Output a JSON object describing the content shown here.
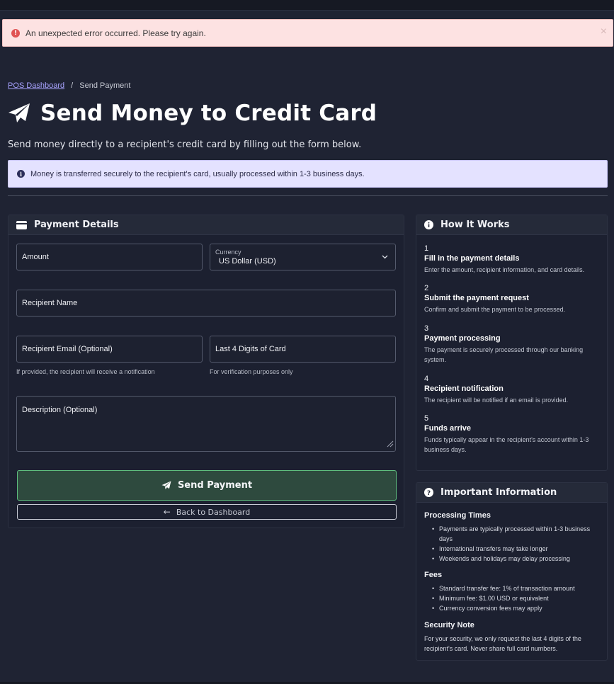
{
  "alert": {
    "message": "An unexpected error occurred. Please try again.",
    "close": "×"
  },
  "breadcrumb": {
    "home": "POS Dashboard",
    "separator": "/",
    "current": "Send Payment"
  },
  "page": {
    "title": "Send Money to Credit Card",
    "subtitle": "Send money directly to a recipient's credit card by filling out the form below.",
    "info": "Money is transferred securely to the recipient's card, usually processed within 1-3 business days."
  },
  "form": {
    "header": "Payment Details",
    "amount_label": "Amount",
    "currency_label": "Currency",
    "currency_value": "US Dollar (USD)",
    "recipient_name_label": "Recipient Name",
    "recipient_email_label": "Recipient Email (Optional)",
    "recipient_email_help": "If provided, the recipient will receive a notification",
    "last4_label": "Last 4 Digits of Card",
    "last4_help": "For verification purposes only",
    "description_label": "Description (Optional)",
    "send_label": "Send Payment",
    "back_label": "Back to Dashboard"
  },
  "how_it_works": {
    "header": "How It Works",
    "steps": [
      {
        "num": "1",
        "title": "Fill in the payment details",
        "desc": "Enter the amount, recipient information, and card details."
      },
      {
        "num": "2",
        "title": "Submit the payment request",
        "desc": "Confirm and submit the payment to be processed."
      },
      {
        "num": "3",
        "title": "Payment processing",
        "desc": "The payment is securely processed through our banking system."
      },
      {
        "num": "4",
        "title": "Recipient notification",
        "desc": "The recipient will be notified if an email is provided."
      },
      {
        "num": "5",
        "title": "Funds arrive",
        "desc": "Funds typically appear in the recipient's account within 1-3 business days."
      }
    ]
  },
  "important": {
    "header": "Important Information",
    "processing_title": "Processing Times",
    "processing_items": [
      "Payments are typically processed within 1-3 business days",
      "International transfers may take longer",
      "Weekends and holidays may delay processing"
    ],
    "fees_title": "Fees",
    "fees_items": [
      "Standard transfer fee: 1% of transaction amount",
      "Minimum fee: $1.00 USD or equivalent",
      "Currency conversion fees may apply"
    ],
    "security_title": "Security Note",
    "security_text": "For your security, we only request the last 4 digits of the recipient's card. Never share full card numbers."
  },
  "colors": {
    "background": "#1f2333",
    "error_bg": "#fde2e2",
    "info_bg": "#e4e2ff",
    "accent_link": "#a8a3ff",
    "send_border": "#5fbf7e"
  }
}
